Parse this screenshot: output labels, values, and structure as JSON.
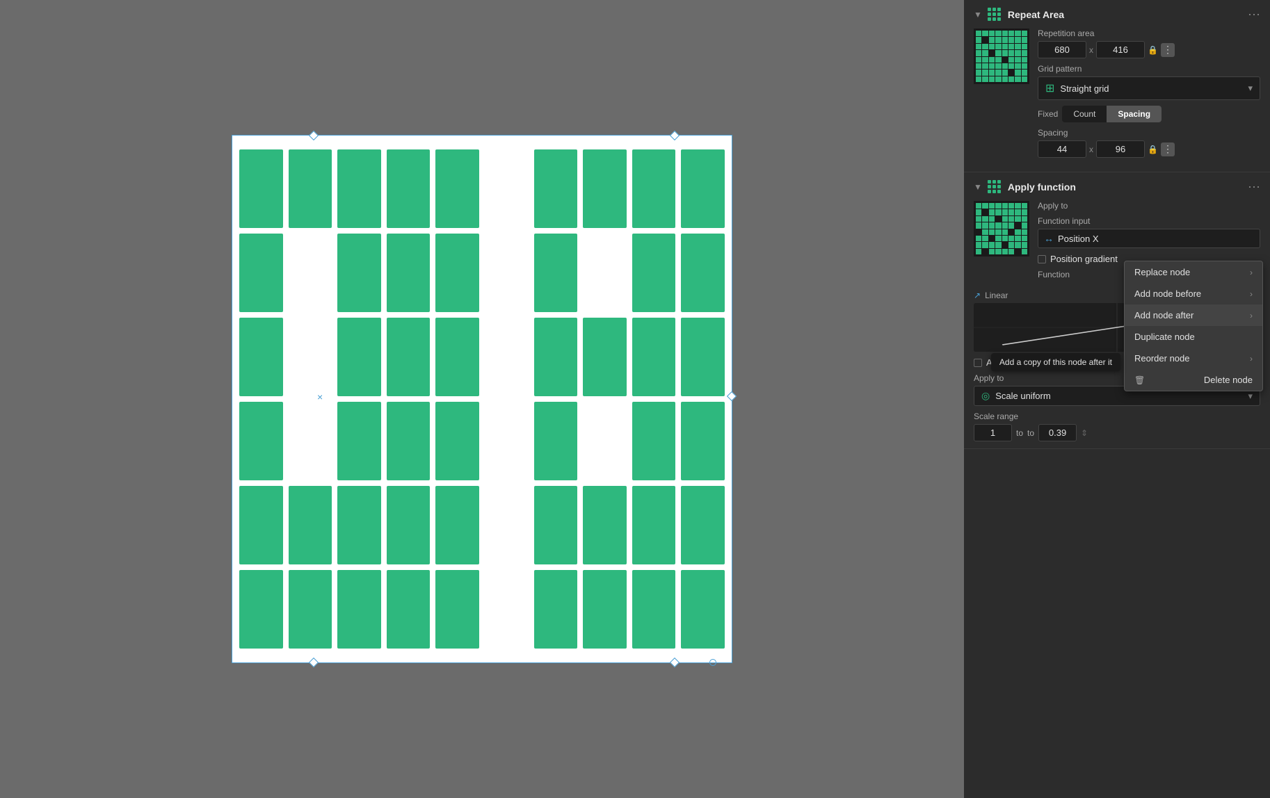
{
  "canvas": {
    "background": "#6b6b6b"
  },
  "panel": {
    "repeat_area": {
      "title": "Repeat Area",
      "repetition_label": "Repetition area",
      "width": "680",
      "height": "416",
      "grid_pattern_label": "Grid pattern",
      "grid_pattern_value": "Straight grid",
      "fixed_label": "Fixed",
      "count_label": "Count",
      "spacing_label": "Spacing",
      "spacing_x": "44",
      "spacing_y": "96"
    },
    "apply_function": {
      "title": "Apply function",
      "apply_to_label": "Apply to",
      "apply_to_value": "",
      "function_input_label": "Function input",
      "position_x_label": "Position X",
      "position_gradient_label": "Position gradient",
      "function_label": "Function",
      "linear_label": "Linear",
      "adjust_periods_label": "Adjust function periods",
      "apply_to_2_label": "Apply to",
      "scale_uniform_label": "Scale uniform",
      "scale_range_label": "Scale range",
      "scale_from": "1",
      "scale_to": "0.39"
    },
    "context_menu": {
      "replace_node": "Replace node",
      "add_node_before": "Add node before",
      "add_node_after": "Add node after",
      "duplicate_node": "Duplicate node",
      "reorder_node": "Reorder node",
      "delete_node": "Delete node"
    },
    "tooltip": {
      "text": "Add a copy of this node after it"
    }
  }
}
